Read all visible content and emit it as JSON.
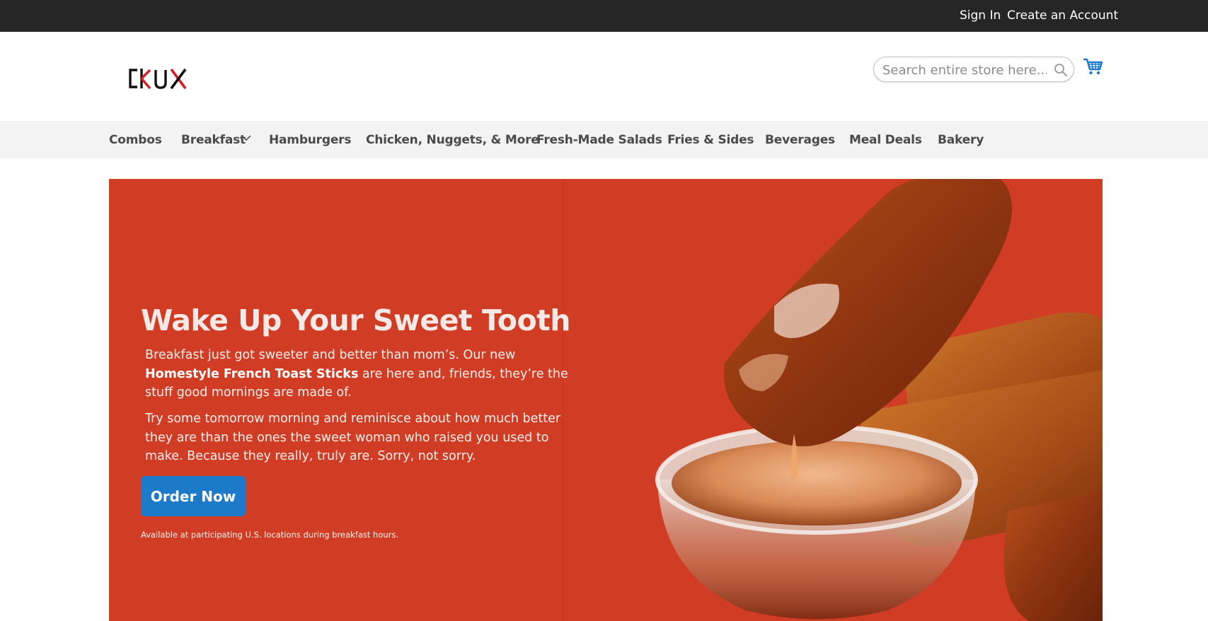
{
  "topbar": {
    "sign_in": "Sign In",
    "create_account": "Create an Account"
  },
  "header": {
    "logo_text": "CRUX",
    "search_placeholder": "Search entire store here...",
    "icons": [
      "search-icon",
      "cart-icon"
    ],
    "accent_color": "#1c7ac9"
  },
  "nav": {
    "items": [
      {
        "label": "Combos"
      },
      {
        "label": "Breakfast",
        "has_submenu": true
      },
      {
        "label": "Hamburgers"
      },
      {
        "label": "Chicken, Nuggets, & More"
      },
      {
        "label": "Fresh-Made Salads"
      },
      {
        "label": "Fries & Sides"
      },
      {
        "label": "Beverages"
      },
      {
        "label": "Meal Deals"
      },
      {
        "label": "Bakery"
      }
    ]
  },
  "hero": {
    "background_color": "#d03c24",
    "title": "Wake Up Your Sweet Tooth",
    "p1_before": "Breakfast just got sweeter and better than mom’s. Our new ",
    "p1_bold": "Homestyle French Toast Sticks",
    "p1_after": " are here and, friends, they’re the stuff good mornings are made of.",
    "p2": "Try some tomorrow morning and reminisce about how much better they are than the ones the sweet woman who raised you used to make. Because they really, truly are. Sorry, not sorry.",
    "cta_label": "Order Now",
    "fineprint": "Available at participating U.S. locations during breakfast hours."
  }
}
